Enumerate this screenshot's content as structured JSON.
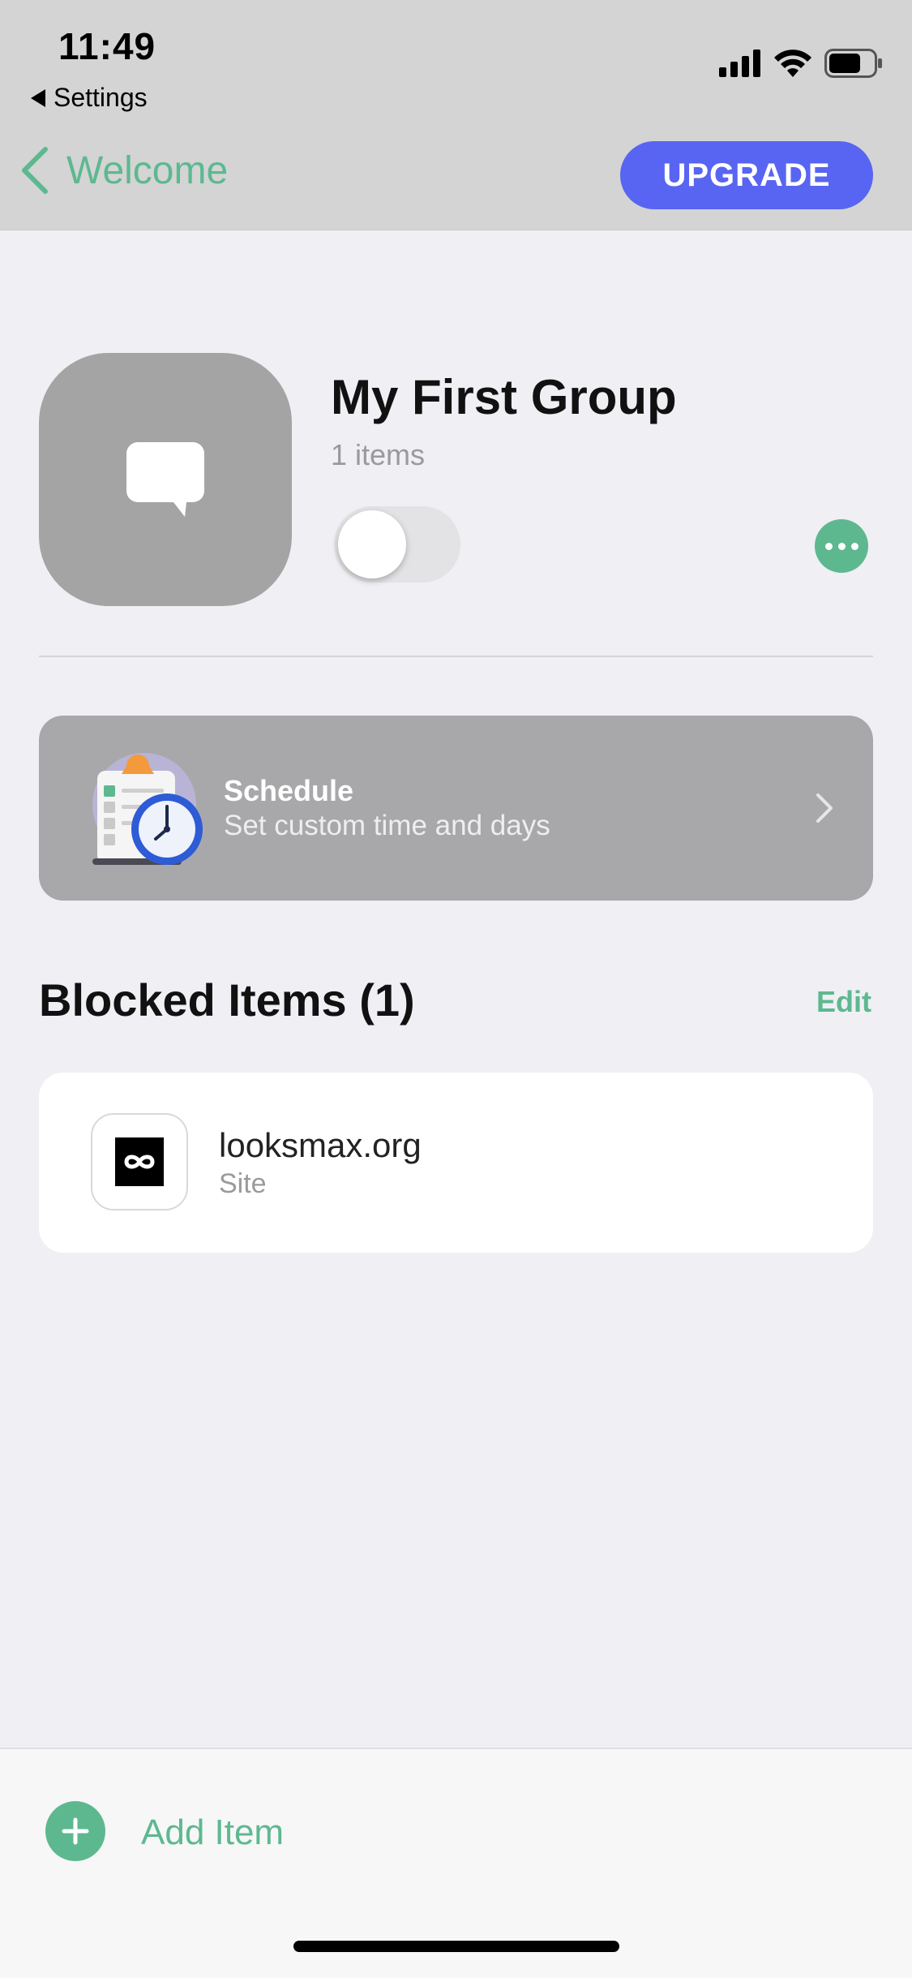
{
  "status_bar": {
    "time": "11:49",
    "back_app_label": "Settings",
    "icons": [
      "cellular-signal-icon",
      "wifi-icon",
      "battery-icon"
    ]
  },
  "nav": {
    "back_label": "Welcome",
    "upgrade_label": "UPGRADE"
  },
  "group": {
    "icon": "chat-bubble-icon",
    "title": "My First Group",
    "item_count": "1 items",
    "enabled": false
  },
  "schedule": {
    "title": "Schedule",
    "subtitle": "Set custom time and days"
  },
  "blocked": {
    "heading": "Blocked Items (1)",
    "edit_label": "Edit",
    "items": [
      {
        "name": "looksmax.org",
        "type": "Site",
        "icon": "site-favicon-icon"
      }
    ]
  },
  "bottom": {
    "add_label": "Add Item"
  },
  "colors": {
    "accent_green": "#5db890",
    "upgrade_blue": "#5865f2",
    "header_gray": "#d4d4d4",
    "background": "#efeff4"
  }
}
